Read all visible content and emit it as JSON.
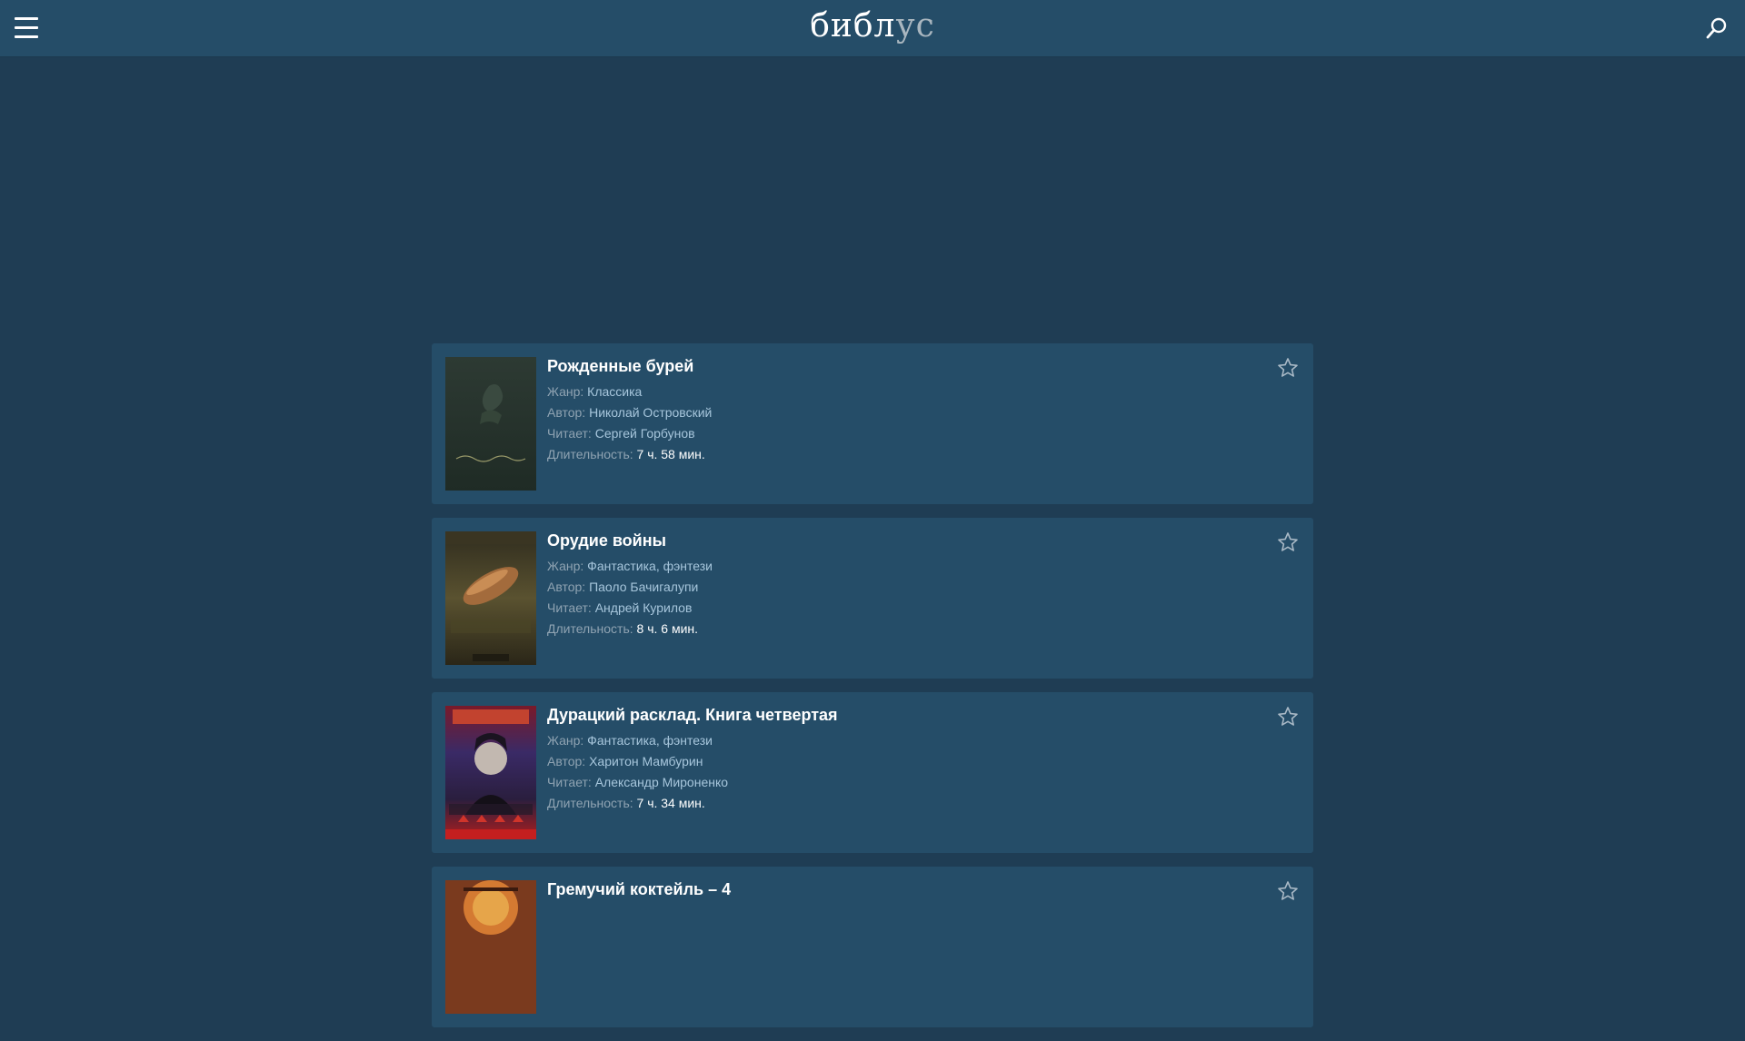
{
  "header": {
    "logo_part1": "библ",
    "logo_part2": "ус",
    "menu_icon": "hamburger-menu-icon",
    "search_icon": "search-icon"
  },
  "labels": {
    "genre": "Жанр:",
    "author": "Автор:",
    "reader": "Читает:",
    "duration": "Длительность:"
  },
  "books": [
    {
      "title": "Рожденные бурей",
      "genre": "Классика",
      "author": "Николай Островский",
      "reader": "Сергей Горбунов",
      "duration": "7 ч. 58 мин."
    },
    {
      "title": "Орудие войны",
      "genre": "Фантастика, фэнтези",
      "author": "Паоло Бачигалупи",
      "reader": "Андрей Курилов",
      "duration": "8 ч. 6 мин."
    },
    {
      "title": "Дурацкий расклад. Книга четвертая",
      "genre": "Фантастика, фэнтези",
      "author": "Харитон Мамбурин",
      "reader": "Александр Мироненко",
      "duration": "7 ч. 34 мин."
    },
    {
      "title": "Гремучий коктейль – 4"
    }
  ],
  "colors": {
    "page_bg": "#1f3d54",
    "card_bg": "#254d68",
    "link": "#a7c6dc",
    "label": "#8fa3b2"
  }
}
